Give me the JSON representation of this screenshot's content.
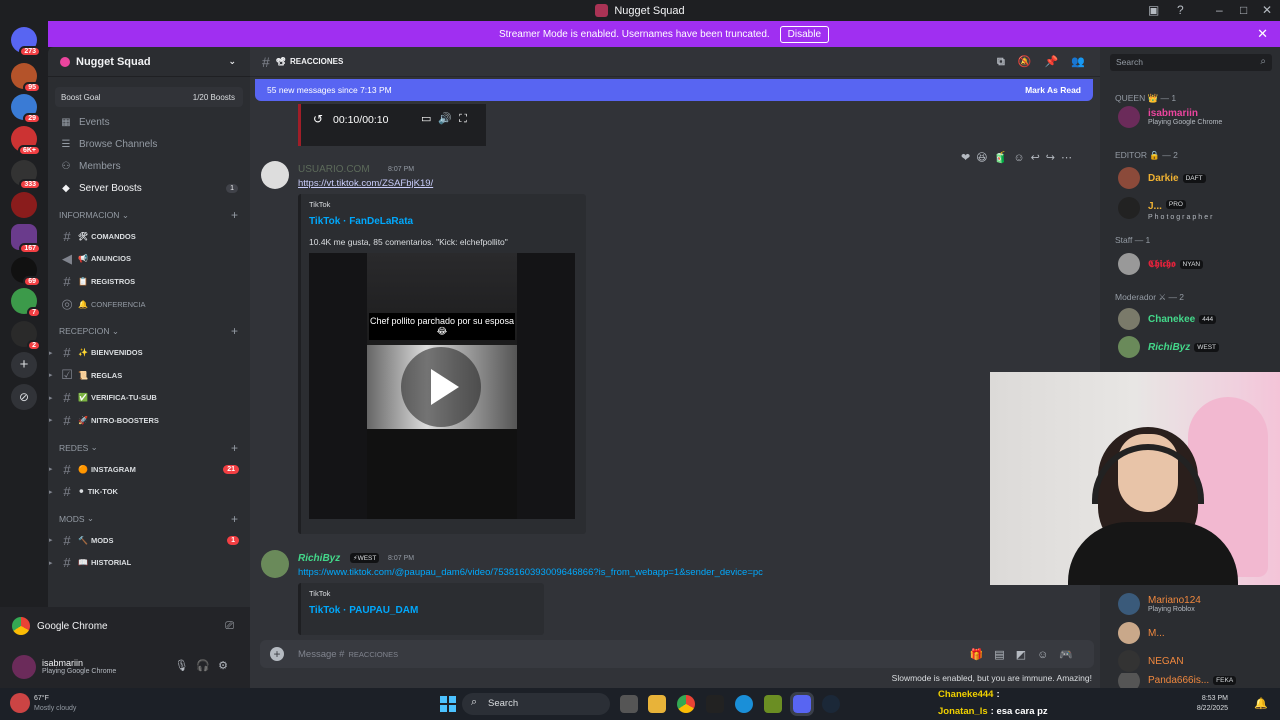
{
  "window": {
    "title": "Nugget Squad"
  },
  "banner": {
    "text": "Streamer Mode is enabled. Usernames have been truncated.",
    "button": "Disable"
  },
  "rail": {
    "badges": [
      "273",
      "95",
      "29",
      "6K+",
      "333",
      "167",
      "69",
      "7",
      "2"
    ]
  },
  "server": {
    "name": "Nugget Squad",
    "boost_label": "Boost Goal",
    "boost_value": "1/20 Boosts"
  },
  "nav": {
    "events": "Events",
    "browse": "Browse Channels",
    "members": "Members",
    "boosts": "Server Boosts",
    "boosts_count": "1"
  },
  "categories": {
    "informacion": "INFORMACION",
    "recepcion": "RECEPCION",
    "redes": "REDES",
    "mods": "MODS"
  },
  "channels": {
    "comandos": "COMANDOS",
    "anuncios": "ANUNCIOS",
    "registros": "REGISTROS",
    "conferencia": "CONFERENCIA",
    "bienvenidos": "BIENVENIDOS",
    "reglas": "REGLAS",
    "verifica": "VERIFICA-TU-SUB",
    "nitro": "NITRO-BOOSTERS",
    "instagram": "INSTAGRAM",
    "instagram_count": "21",
    "tiktok": "TIK-TOK",
    "mods": "MODS",
    "mods_count": "1",
    "historial": "HISTORIAL"
  },
  "voice": {
    "app": "Google Chrome"
  },
  "user": {
    "name": "isabmariin",
    "status": "Playing Google Chrome"
  },
  "chat": {
    "channel": "REACCIONES",
    "new_messages": "55 new messages since 7:13 PM",
    "mark_read": "Mark As Read",
    "player_time": "00:10/00:10",
    "msg1": {
      "author": "USUARIO.COM",
      "time": "8:07 PM",
      "link": "https://vt.tiktok.com/ZSAFbjK19/",
      "provider": "TikTok",
      "title": "TikTok · FanDeLaRata",
      "desc": "10.4K me gusta, 85 comentarios. \"Kick: elchefpollito\"",
      "video_caption": "Chef pollito parchado por su esposa 😂"
    },
    "msg2": {
      "author": "RichiByz",
      "tag": "WEST",
      "time": "8:07 PM",
      "link": "https://www.tiktok.com/@paupau_dam6/video/7538160393009646866?is_from_webapp=1&sender_device=pc",
      "provider": "TikTok",
      "title": "TikTok · PAUPAU_DAM"
    },
    "composer_placeholder": "Message #",
    "composer_channel": "REACCIONES",
    "slowmode": "Slowmode is enabled, but you are immune. Amazing!"
  },
  "members": {
    "search_placeholder": "Search",
    "roles": {
      "queen": "QUEEN 👑 — 1",
      "editor": "EDITOR 🔒 — 2",
      "staff": "Staff — 1",
      "moderador": "Moderador ⚔ — 2"
    },
    "list": [
      {
        "name": "isabmariin",
        "sub": "Playing Google Chrome",
        "color": "#eb459e"
      },
      {
        "name": "Darkie",
        "sub": "DAFT",
        "color": "#f0b232"
      },
      {
        "name": "J...",
        "sub": "Photographer",
        "tag": "PRO",
        "color": "#f0b232"
      },
      {
        "name": "𝕮𝖍𝖎𝖈𝖍𝖔",
        "sub": "NYAN",
        "color": "#e0223b"
      },
      {
        "name": "Chanekee",
        "sub": "444",
        "color": "#43d88a"
      },
      {
        "name": "RichiByz",
        "sub": "WEST",
        "color": "#43d88a"
      },
      {
        "name": "Mariano124",
        "sub": "Playing Roblox",
        "color": "#f0883e"
      },
      {
        "name": "M...",
        "sub": "",
        "color": "#f0883e"
      },
      {
        "name": "NEGAN",
        "sub": "",
        "color": "#f0883e"
      },
      {
        "name": "Panda666is...",
        "sub": "FEKA",
        "color": "#f0883e"
      }
    ]
  },
  "taskbar": {
    "weather_temp": "67°F",
    "weather_desc": "Mostly cloudy",
    "search": "Search",
    "chat1_user": "Chaneke444",
    "chat1_text": ":",
    "chat2_user": "Jonatan_ls",
    "chat2_text": ": esa cara pz",
    "time": "8:53 PM",
    "date": "8/22/2025"
  }
}
